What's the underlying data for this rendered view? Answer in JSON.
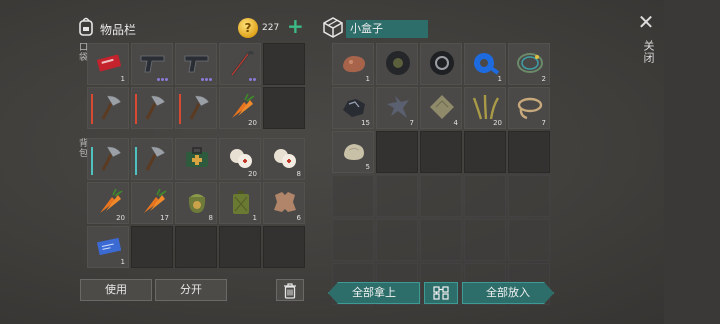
{
  "inventory": {
    "title": "物品栏",
    "icon": "backpack-icon",
    "coins": "227",
    "coin_glyph": "?",
    "add_label": "+",
    "pocket_label": "口袋",
    "backpack_label": "背包"
  },
  "box": {
    "title": "小盒子",
    "icon": "box-icon"
  },
  "close_label": "关闭",
  "buttons": {
    "use": "使用",
    "split": "分开",
    "take_all": "全部拿上",
    "put_all": "全部放入",
    "trash_icon": "trash-icon",
    "sort_icon": "sort-icon"
  },
  "pocket": [
    {
      "item": "red-ticket",
      "qty": "1"
    },
    {
      "item": "pistol",
      "dots": 3
    },
    {
      "item": "pistol",
      "dots": 3
    },
    {
      "item": "crowbar",
      "dots": 2
    },
    {
      "item": "empty"
    },
    {
      "item": "hatchet",
      "bar": "red"
    },
    {
      "item": "hatchet",
      "bar": "red"
    },
    {
      "item": "hatchet",
      "bar": "red"
    },
    {
      "item": "carrot",
      "qty": "20"
    },
    {
      "item": "empty"
    }
  ],
  "backpack": [
    {
      "item": "hatchet",
      "bar": "cyan"
    },
    {
      "item": "hatchet",
      "bar": "cyan"
    },
    {
      "item": "medkit"
    },
    {
      "item": "bandage",
      "qty": "20"
    },
    {
      "item": "bandage",
      "qty": "8"
    },
    {
      "item": "carrot",
      "qty": "20"
    },
    {
      "item": "carrot",
      "qty": "17"
    },
    {
      "item": "seed-bag",
      "qty": "8"
    },
    {
      "item": "jerrycan",
      "qty": "1"
    },
    {
      "item": "leather",
      "qty": "6"
    },
    {
      "item": "blueprint",
      "qty": "1"
    },
    {
      "item": "empty"
    },
    {
      "item": "empty"
    },
    {
      "item": "empty"
    },
    {
      "item": "empty"
    }
  ],
  "box_items": [
    {
      "item": "copper-ore",
      "qty": "1"
    },
    {
      "item": "tire",
      "qty": ""
    },
    {
      "item": "tire-wheel",
      "qty": ""
    },
    {
      "item": "blue-tape",
      "qty": "1"
    },
    {
      "item": "wire-coil",
      "qty": "2"
    },
    {
      "item": "iron-ore",
      "qty": "15"
    },
    {
      "item": "scrap-metal",
      "qty": "7"
    },
    {
      "item": "cloth",
      "qty": "4"
    },
    {
      "item": "plant-fiber",
      "qty": "20"
    },
    {
      "item": "rope",
      "qty": "7"
    },
    {
      "item": "stone",
      "qty": "5"
    },
    {
      "item": "empty"
    },
    {
      "item": "empty"
    },
    {
      "item": "empty"
    },
    {
      "item": "empty"
    },
    {
      "item": "empty"
    },
    {
      "item": "empty"
    },
    {
      "item": "empty"
    },
    {
      "item": "empty"
    },
    {
      "item": "empty"
    },
    {
      "item": "empty"
    },
    {
      "item": "empty"
    },
    {
      "item": "empty"
    },
    {
      "item": "empty"
    },
    {
      "item": "empty"
    },
    {
      "item": "empty"
    },
    {
      "item": "empty"
    },
    {
      "item": "empty"
    },
    {
      "item": "empty"
    },
    {
      "item": "empty"
    }
  ]
}
